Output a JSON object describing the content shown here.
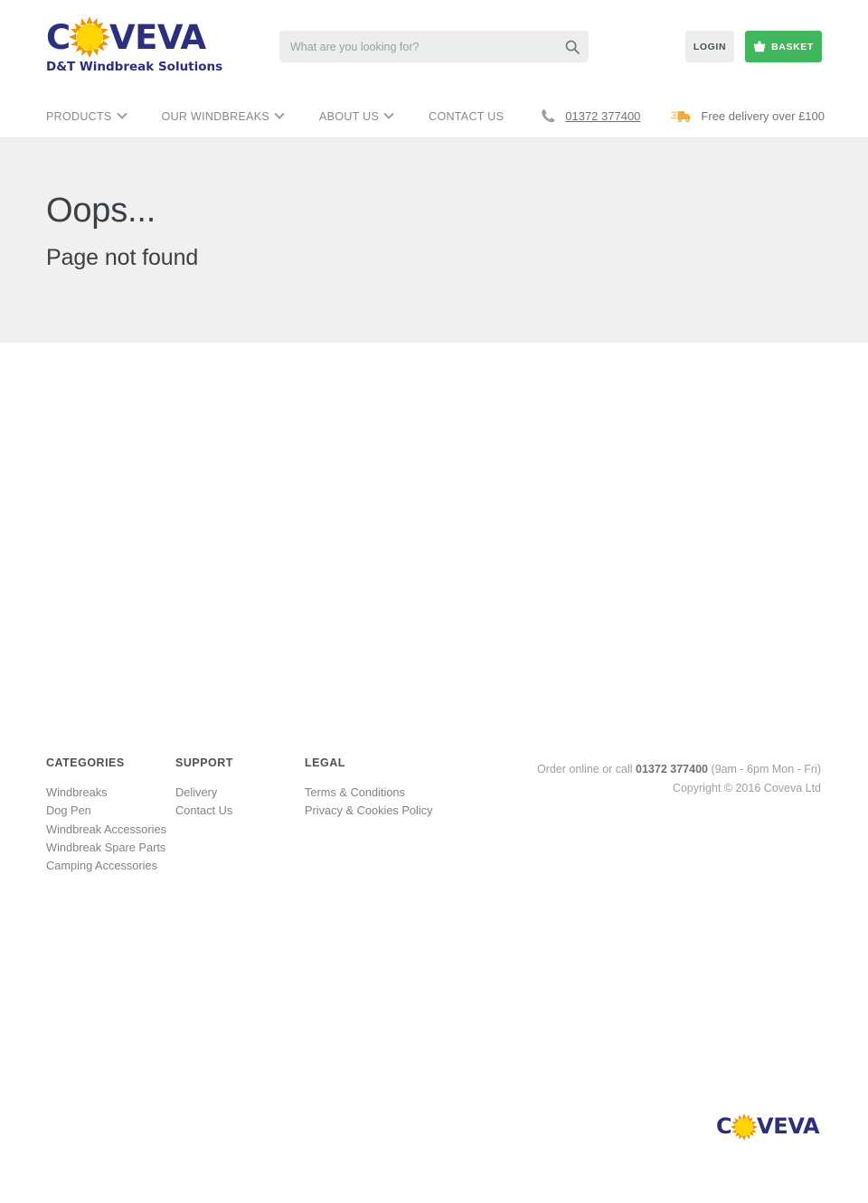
{
  "brand": {
    "logo_letter_c": "C",
    "logo_rest": "VEVA",
    "tagline": "D&T Windbreak Solutions",
    "navy": "#2b2f7e",
    "sun_yellow": "#ffd400",
    "sun_orange": "#f39200",
    "accent_green": "#41b75d"
  },
  "header": {
    "search": {
      "placeholder": "What are you looking for?",
      "value": "",
      "icon": "search-icon"
    },
    "login_label": "LOGIN",
    "basket_label": "BASKET",
    "basket_icon": "shopping-basket-icon"
  },
  "nav": {
    "items": [
      {
        "label": "PRODUCTS",
        "has_dropdown": true
      },
      {
        "label": "OUR WINDBREAKS",
        "has_dropdown": true
      },
      {
        "label": "ABOUT US",
        "has_dropdown": true
      },
      {
        "label": "CONTACT US",
        "has_dropdown": false
      }
    ],
    "info": [
      {
        "icon": "phone-icon",
        "label": "01372 377400"
      },
      {
        "icon": "delivery-truck-icon",
        "label": "Free delivery over £100"
      }
    ]
  },
  "hero": {
    "title": "Oops...",
    "subtitle": "Page not found"
  },
  "footer": {
    "columns": [
      {
        "heading": "CATEGORIES",
        "links": [
          "Windbreaks",
          "Dog Pen",
          "Windbreak Accessories",
          "Windbreak Spare Parts",
          "Camping Accessories"
        ]
      },
      {
        "heading": "SUPPORT",
        "links": [
          "Delivery",
          "Contact Us"
        ]
      },
      {
        "heading": "LEGAL",
        "links": [
          "Terms & Conditions",
          "Privacy & Cookies Policy"
        ]
      }
    ],
    "order_line_prefix": "Order online or call ",
    "order_phone": "01372 377400",
    "order_line_suffix": " (9am - 6pm Mon - Fri)",
    "copyright": "Copyright © 2016 Coveva Ltd"
  }
}
